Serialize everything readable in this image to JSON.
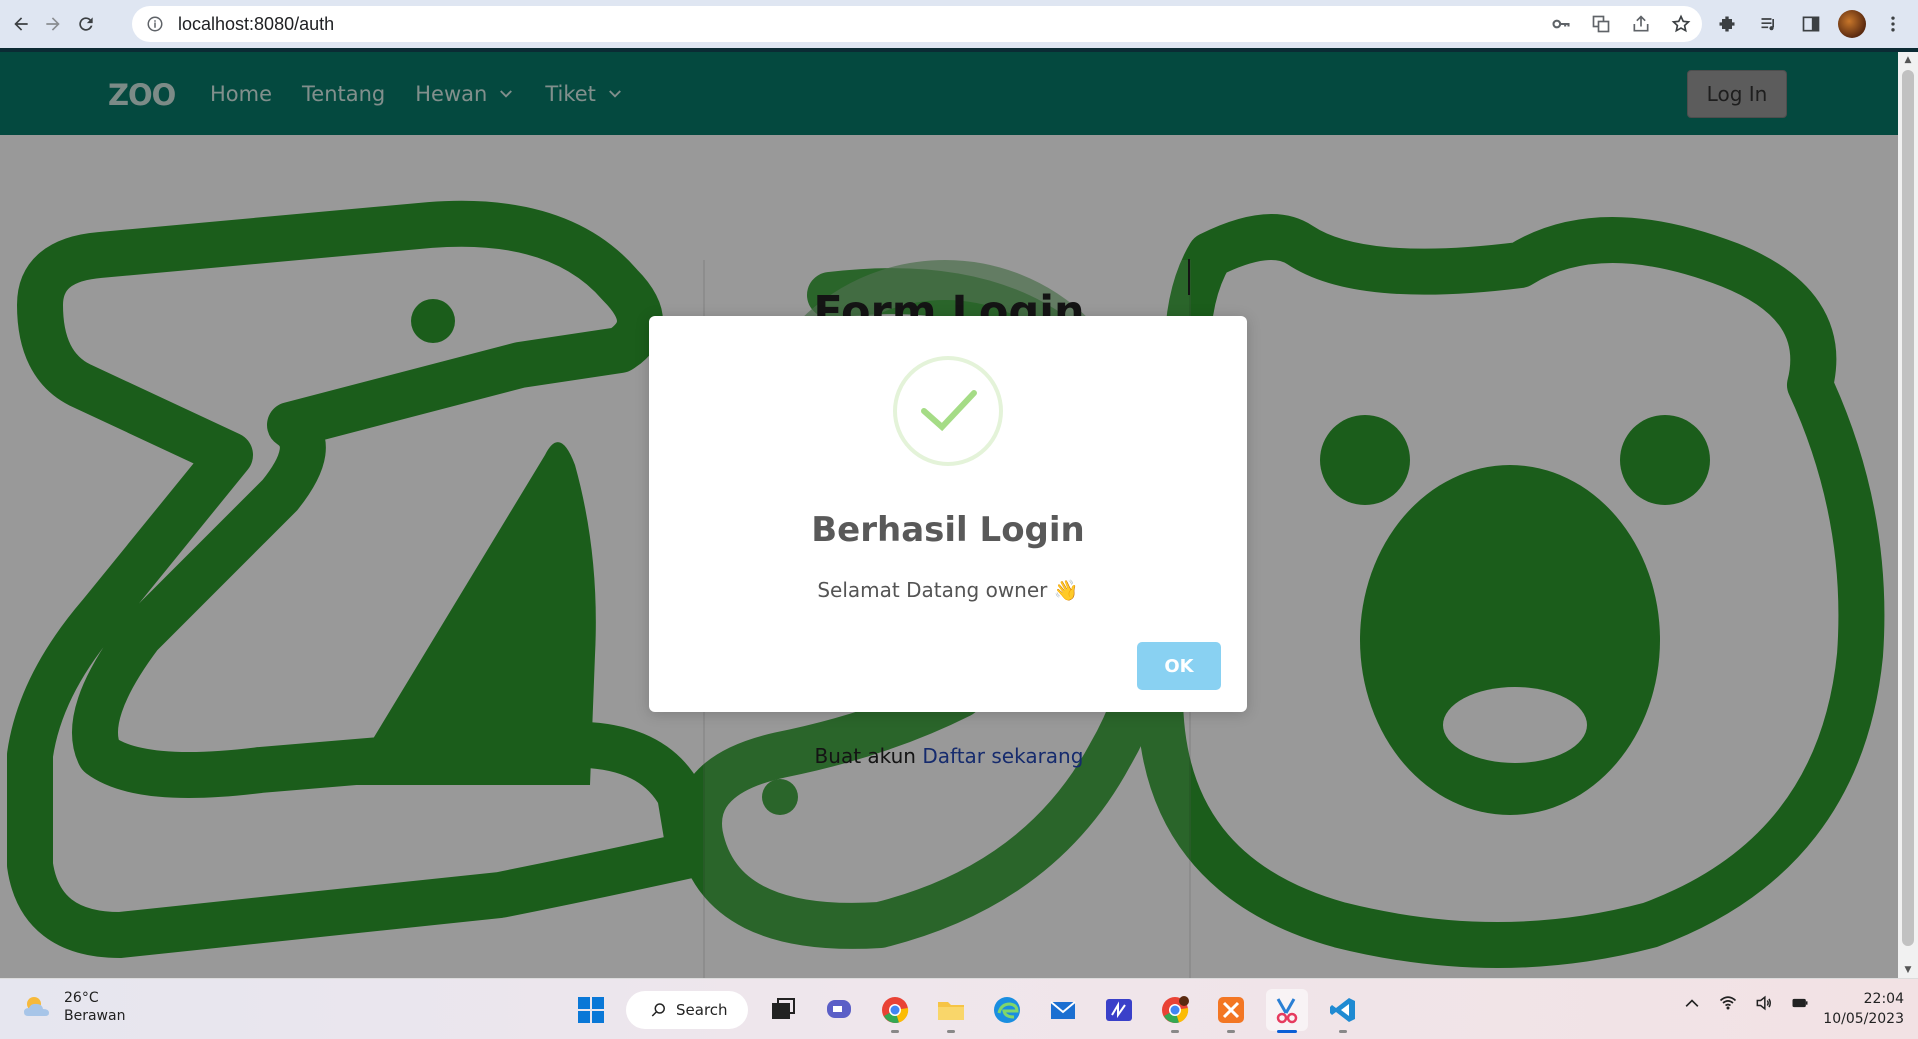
{
  "browser": {
    "url": "localhost:8080/auth"
  },
  "site": {
    "logo": "ZOO",
    "nav": [
      {
        "label": "Home",
        "dropdown": false
      },
      {
        "label": "Tentang",
        "dropdown": false
      },
      {
        "label": "Hewan",
        "dropdown": true
      },
      {
        "label": "Tiket",
        "dropdown": true
      }
    ],
    "login_button": "Log In",
    "accent_color": "#087a6a"
  },
  "form": {
    "title": "Form Login",
    "signup_prefix": "Buat akun",
    "signup_link": "Daftar sekarang"
  },
  "modal": {
    "icon": "success-check-icon",
    "title": "Berhasil Login",
    "message": "Selamat Datang owner 👋",
    "ok_label": "OK"
  },
  "taskbar": {
    "weather_temp": "26°C",
    "weather_desc": "Berawan",
    "search_label": "Search",
    "time": "22:04",
    "date": "10/05/2023",
    "apps": [
      "windows-start",
      "search",
      "task-view",
      "chat",
      "chrome",
      "file-explorer",
      "edge",
      "mail",
      "visual-studio",
      "chrome-profile",
      "xampp",
      "snipping-tool",
      "vscode"
    ]
  }
}
